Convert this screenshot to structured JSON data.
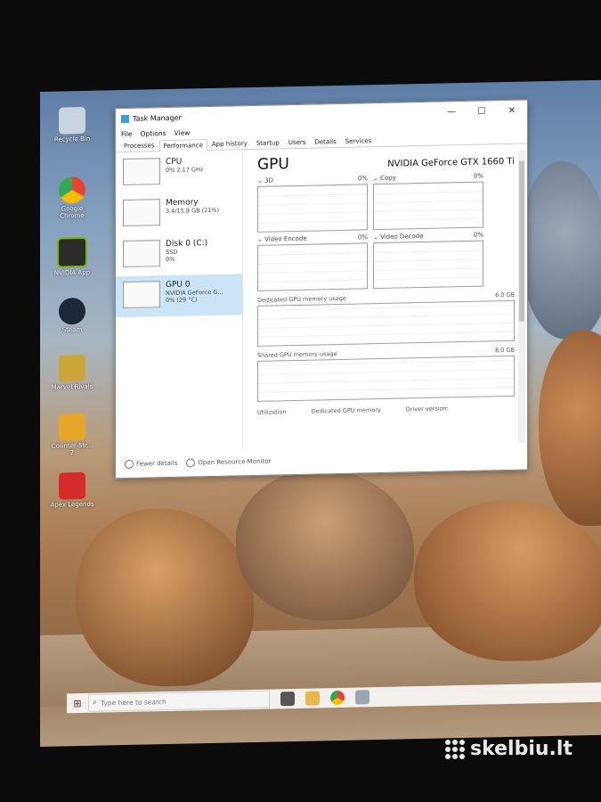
{
  "desktop": {
    "icons": [
      {
        "label": "Recycle Bin",
        "icon": "recycle-bin-icon",
        "color": "#c8d4e0"
      },
      {
        "label": "Google Chrome",
        "icon": "chrome-icon",
        "color": "#e94235"
      },
      {
        "label": "NVIDIA App",
        "icon": "nvidia-icon",
        "color": "#2b2b2b"
      },
      {
        "label": "Steam",
        "icon": "steam-icon",
        "color": "#1b2838"
      },
      {
        "label": "Marvel Rivals",
        "icon": "marvel-rivals-icon",
        "color": "#caa63a"
      },
      {
        "label": "Counter-Str... 2",
        "icon": "counter-strike-icon",
        "color": "#e7a52a"
      },
      {
        "label": "Apex Legends",
        "icon": "apex-icon",
        "color": "#d62b2b"
      }
    ]
  },
  "window": {
    "title": "Task Manager",
    "controls": {
      "minimize": "—",
      "maximize": "☐",
      "close": "✕"
    },
    "menu": [
      "File",
      "Options",
      "View"
    ],
    "tabs": [
      "Processes",
      "Performance",
      "App history",
      "Startup",
      "Users",
      "Details",
      "Services"
    ],
    "active_tab": "Performance"
  },
  "resources": [
    {
      "name": "CPU",
      "line1": "0% 2.17 GHz",
      "line2": ""
    },
    {
      "name": "Memory",
      "line1": "3.4/15.9 GB (21%)",
      "line2": ""
    },
    {
      "name": "Disk 0 (C:)",
      "line1": "SSD",
      "line2": "0%"
    },
    {
      "name": "GPU 0",
      "line1": "NVIDIA GeForce G...",
      "line2": "0% (29 °C)"
    }
  ],
  "gpu": {
    "title": "GPU",
    "model": "NVIDIA GeForce GTX 1660 Ti",
    "graphs": [
      {
        "label": "3D",
        "value": "0%"
      },
      {
        "label": "Copy",
        "value": "0%"
      },
      {
        "label": "Video Encode",
        "value": "0%"
      },
      {
        "label": "Video Decode",
        "value": "0%"
      }
    ],
    "dedicated_label": "Dedicated GPU memory usage",
    "dedicated_value": "6.0 GB",
    "shared_label": "Shared GPU memory usage",
    "shared_value": "8.0 GB",
    "stats": [
      "Utilization",
      "Dedicated GPU memory",
      "Driver version:"
    ]
  },
  "footer": {
    "fewer_details": "Fewer details",
    "open_monitor": "Open Resource Monitor"
  },
  "taskbar": {
    "search_placeholder": "Type here to search"
  },
  "watermark": "skelbiu.lt"
}
